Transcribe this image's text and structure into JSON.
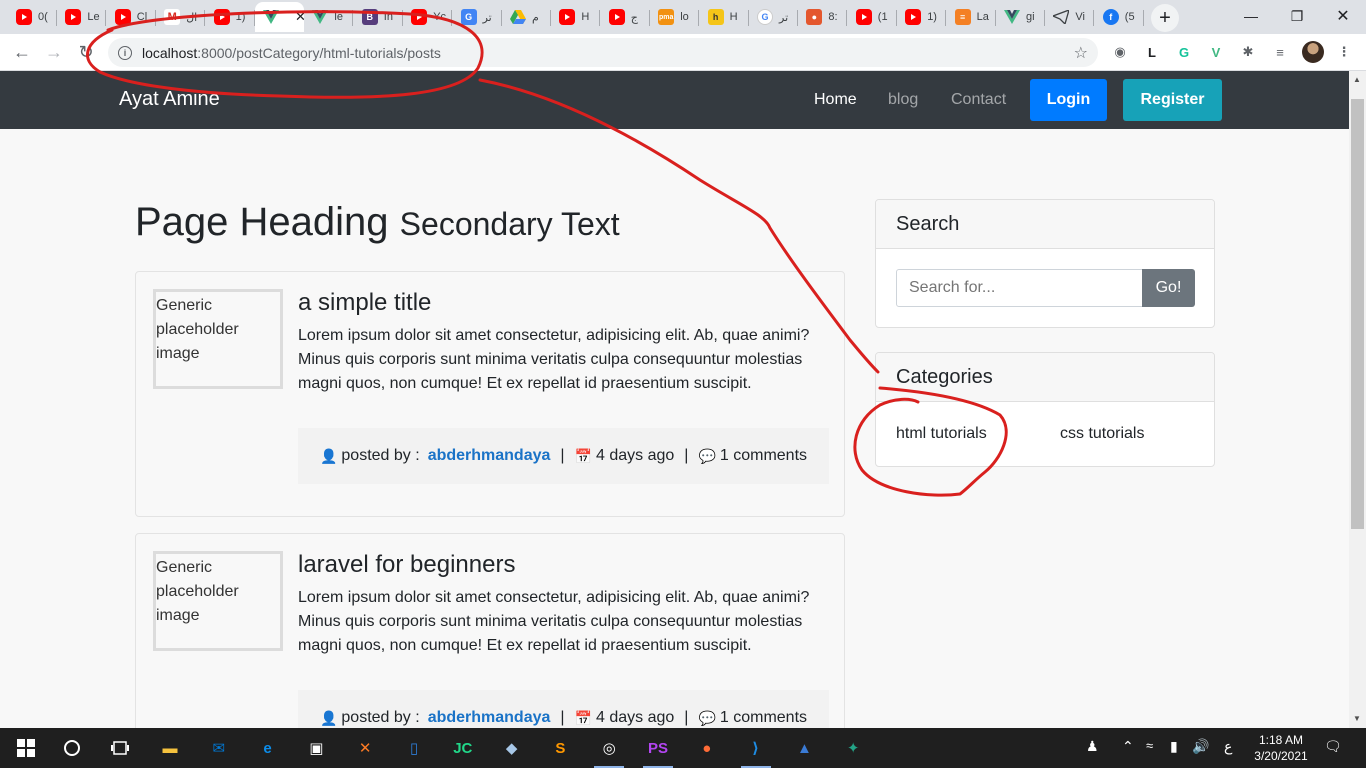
{
  "browser": {
    "tabs": [
      {
        "icon": "youtube-icon",
        "label": "0("
      },
      {
        "icon": "youtube-icon",
        "label": "Le"
      },
      {
        "icon": "youtube-icon",
        "label": "Cl"
      },
      {
        "icon": "gmail-icon",
        "label": "ال"
      },
      {
        "icon": "youtube-icon",
        "label": "1)"
      },
      {
        "icon": "vue-icon",
        "label": "",
        "active": true
      },
      {
        "icon": "vue-icon",
        "label": "le"
      },
      {
        "icon": "bootstrap-icon",
        "label": "In"
      },
      {
        "icon": "youtube-icon",
        "label": "Yc"
      },
      {
        "icon": "google-translate-icon",
        "label": "تر"
      },
      {
        "icon": "google-drive-icon",
        "label": "م"
      },
      {
        "icon": "youtube-icon",
        "label": "H"
      },
      {
        "icon": "youtube-icon",
        "label": "ج"
      },
      {
        "icon": "phpmyadmin-icon",
        "label": "lo"
      },
      {
        "icon": "hostinger-icon",
        "label": "H"
      },
      {
        "icon": "google-icon",
        "label": "تر"
      },
      {
        "icon": "octopus-icon",
        "label": "8:"
      },
      {
        "icon": "youtube-icon",
        "label": "(1"
      },
      {
        "icon": "youtube-icon",
        "label": "1)"
      },
      {
        "icon": "stackoverflow-icon",
        "label": "La"
      },
      {
        "icon": "vue-icon",
        "label": "gi"
      },
      {
        "icon": "telegram-icon",
        "label": "Vi"
      },
      {
        "icon": "facebook-icon",
        "label": "(5"
      }
    ],
    "new_tab_glyph": "+",
    "url_host": "localhost",
    "url_path": ":8000/postCategory/html-tutorials/posts",
    "extensions": [
      "camera-icon",
      "l-extension-icon",
      "grammarly-icon",
      "vue-devtools-icon",
      "puzzle-icon",
      "playlist-icon"
    ],
    "extension_glyphs": [
      "◉",
      "L",
      "G",
      "V",
      "✱",
      "≡"
    ]
  },
  "site": {
    "brand": "Ayat Amine",
    "nav": {
      "home": "Home",
      "blog": "blog",
      "contact": "Contact",
      "login": "Login",
      "register": "Register"
    },
    "heading": "Page Heading",
    "heading_secondary": "Secondary Text",
    "posts": [
      {
        "img_alt": "Generic placeholder image",
        "title": "a simple title",
        "body": "Lorem ipsum dolor sit amet consectetur, adipisicing elit. Ab, quae animi? Minus quis corporis sunt minima veritatis culpa consequuntur molestias magni quos, non cumque! Et ex repellat id praesentium suscipit.",
        "posted_by_label": "posted by :",
        "author": "abderhmandaya",
        "date": "4 days ago",
        "comments": "1 comments"
      },
      {
        "img_alt": "Generic placeholder image",
        "title": "laravel for beginners",
        "body": "Lorem ipsum dolor sit amet consectetur, adipisicing elit. Ab, quae animi? Minus quis corporis sunt minima veritatis culpa consequuntur molestias magni quos, non cumque! Et ex repellat id praesentium suscipit.",
        "posted_by_label": "posted by :",
        "author": "abderhmandaya",
        "date": "4 days ago",
        "comments": "1 comments"
      }
    ],
    "search": {
      "title": "Search",
      "placeholder": "Search for...",
      "button": "Go!"
    },
    "categories": {
      "title": "Categories",
      "items": [
        "html tutorials",
        "css tutorials"
      ]
    }
  },
  "taskbar": {
    "apps": [
      "explorer-icon",
      "mail-icon",
      "edge-icon",
      "store-icon",
      "xampp-icon",
      "unknown-app-icon",
      "jetbrains-icon",
      "box-icon",
      "sublime-icon",
      "chrome-icon",
      "phpstorm-icon",
      "postman-icon",
      "vscode-icon",
      "photos-icon",
      "gitkraken-icon"
    ],
    "lang": "ع",
    "time": "1:18 AM",
    "date": "3/20/2021"
  },
  "colors": {
    "navbar_bg": "#343a40",
    "login_btn": "#007bff",
    "register_btn": "#17a2b8",
    "author_link": "#1a73c7",
    "annotation": "#d9201e"
  }
}
